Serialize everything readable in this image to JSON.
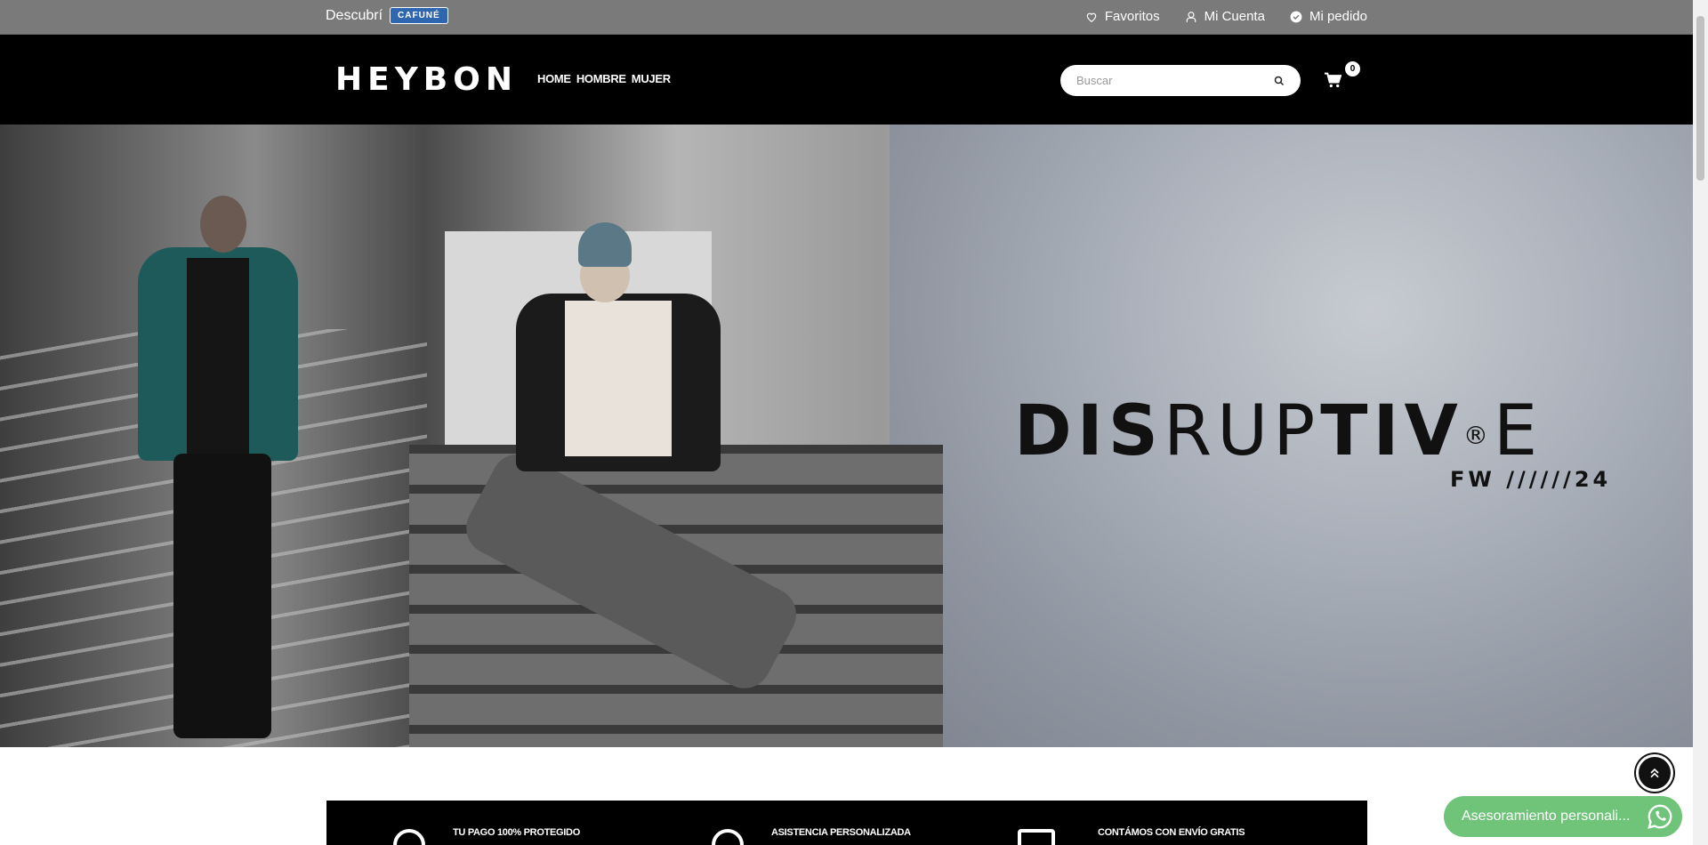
{
  "topbar": {
    "discover_label": "Descubrí",
    "badge_label": "CAFUNÉ",
    "links": [
      {
        "label": "Favoritos",
        "icon": "heart-icon"
      },
      {
        "label": "Mi Cuenta",
        "icon": "user-icon"
      },
      {
        "label": "Mi pedido",
        "icon": "check-circle-icon"
      }
    ]
  },
  "header": {
    "logo": "HEYBON",
    "nav": [
      "HOME",
      "HOMBRE",
      "MUJER"
    ],
    "search_placeholder": "Buscar",
    "cart_count": "0"
  },
  "hero": {
    "title_bold_1": "DIS",
    "title_thin": "RUP",
    "title_bold_2": "TIV",
    "title_symbol": "®",
    "title_end": "E",
    "subtitle": "FW //////24"
  },
  "features": [
    {
      "label": "TU PAGO 100% PROTEGIDO",
      "icon": "shield-icon"
    },
    {
      "label": "ASISTENCIA PERSONALIZADA",
      "icon": "headset-icon"
    },
    {
      "label": "CONTÁMOS CON ENVÍO GRATIS",
      "icon": "truck-icon"
    }
  ],
  "chat": {
    "label": "Asesoramiento personali...",
    "icon": "whatsapp-icon"
  },
  "colors": {
    "topbar_bg": "#7a7a7a",
    "header_bg": "#000000",
    "badge_bg": "#2e67b0",
    "chat_bg": "#6fc47a"
  }
}
